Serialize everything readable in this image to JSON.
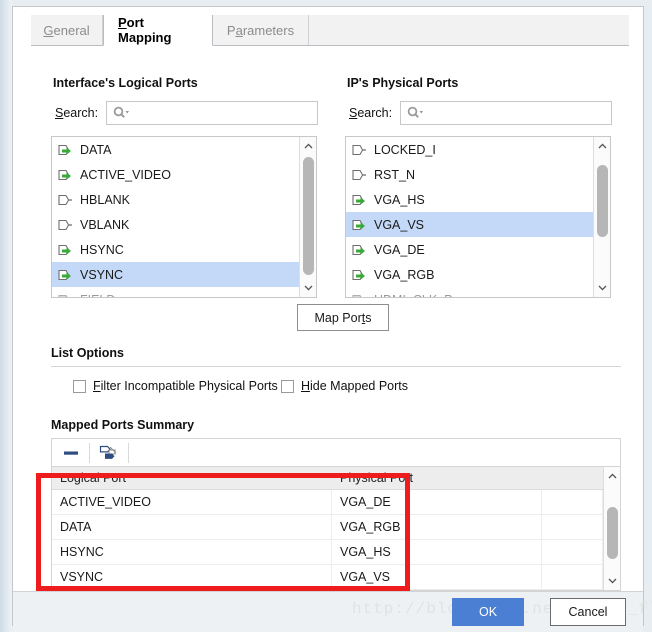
{
  "tabs": [
    {
      "label": "General",
      "mnemonic": "G",
      "active": false
    },
    {
      "label": "Port Mapping",
      "mnemonic": "P",
      "active": true
    },
    {
      "label": "Parameters",
      "mnemonic": "a",
      "active": false
    }
  ],
  "left_panel": {
    "title": "Interface's Logical Ports",
    "search_label": "Search:",
    "search_value": "",
    "search_placeholder": "",
    "items": [
      {
        "label": "DATA",
        "mapped": true,
        "selected": false,
        "faded": false
      },
      {
        "label": "ACTIVE_VIDEO",
        "mapped": true,
        "selected": false,
        "faded": false
      },
      {
        "label": "HBLANK",
        "mapped": false,
        "selected": false,
        "faded": false
      },
      {
        "label": "VBLANK",
        "mapped": false,
        "selected": false,
        "faded": false
      },
      {
        "label": "HSYNC",
        "mapped": true,
        "selected": false,
        "faded": false
      },
      {
        "label": "VSYNC",
        "mapped": true,
        "selected": true,
        "faded": false
      },
      {
        "label": "FIELD",
        "mapped": false,
        "selected": false,
        "faded": true
      }
    ]
  },
  "right_panel": {
    "title": "IP's Physical Ports",
    "search_label": "Search:",
    "search_value": "",
    "search_placeholder": "",
    "items": [
      {
        "label": "LOCKED_I",
        "mapped": false,
        "selected": false,
        "faded": false
      },
      {
        "label": "RST_N",
        "mapped": false,
        "selected": false,
        "faded": false
      },
      {
        "label": "VGA_HS",
        "mapped": true,
        "selected": false,
        "faded": false
      },
      {
        "label": "VGA_VS",
        "mapped": true,
        "selected": true,
        "faded": false
      },
      {
        "label": "VGA_DE",
        "mapped": true,
        "selected": false,
        "faded": false
      },
      {
        "label": "VGA_RGB",
        "mapped": true,
        "selected": false,
        "faded": false
      },
      {
        "label": "HDMI_CLK_P",
        "mapped": false,
        "selected": false,
        "faded": true
      }
    ]
  },
  "map_ports_button": {
    "label": "Map Ports",
    "mnemonic": "t"
  },
  "list_options": {
    "title": "List Options",
    "checkboxes": [
      {
        "label": "Filter Incompatible Physical Ports",
        "mnemonic": "F",
        "checked": false
      },
      {
        "label": "Hide Mapped Ports",
        "mnemonic": "H",
        "checked": false
      }
    ]
  },
  "mapped_ports_summary": {
    "title": "Mapped Ports Summary",
    "toolbar": [
      {
        "icon": "minus-icon",
        "name": "delete-mapping-button"
      },
      {
        "icon": "auto-map-icon",
        "name": "auto-map-button"
      }
    ],
    "columns": [
      "Logical Port",
      "Physical Port"
    ],
    "rows": [
      {
        "logical": "ACTIVE_VIDEO",
        "physical": "VGA_DE"
      },
      {
        "logical": "DATA",
        "physical": "VGA_RGB"
      },
      {
        "logical": "HSYNC",
        "physical": "VGA_HS"
      },
      {
        "logical": "VSYNC",
        "physical": "VGA_VS"
      }
    ]
  },
  "footer": {
    "ok_label": "OK",
    "cancel_label": "Cancel"
  },
  "watermark": {
    "text": "http://blog.csdn.net/liang_fly"
  },
  "colors": {
    "selection_blue": "#c3d9f7",
    "ok_blue": "#4a7fd4",
    "annotation_red": "#ee1c1c",
    "mapped_green": "#3aa93a"
  }
}
